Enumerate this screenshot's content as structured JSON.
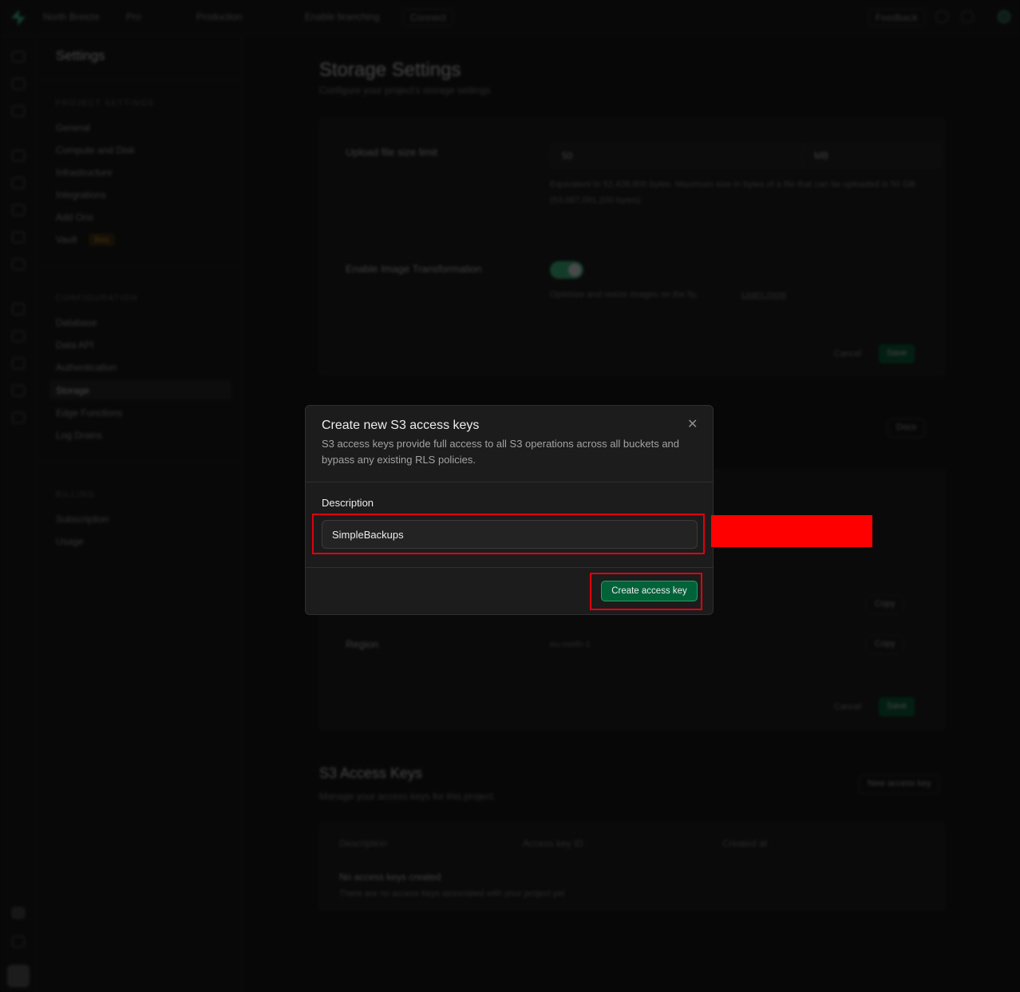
{
  "topbar": {
    "org": "North Breeze",
    "plan": "Pro",
    "branch": "Production",
    "branching": "Enable branching",
    "connect": "Connect",
    "feedback": "Feedback"
  },
  "sidebar": {
    "title": "Settings",
    "sections": [
      {
        "heading": "PROJECT SETTINGS",
        "items": [
          "General",
          "Compute and Disk",
          "Infrastructure",
          "Integrations",
          "Add Ons",
          "Vault"
        ]
      },
      {
        "heading": "CONFIGURATION",
        "items": [
          "Database",
          "Data API",
          "Authentication",
          "Storage",
          "Edge Functions",
          "Log Drains"
        ]
      },
      {
        "heading": "BILLING",
        "items": [
          "Subscription",
          "Usage"
        ]
      }
    ],
    "vault_badge": "Beta",
    "active_item": "Storage"
  },
  "main": {
    "title": "Storage Settings",
    "subtitle": "Configure your project's storage settings",
    "upload_label": "Upload file size limit",
    "upload_value": "50",
    "upload_unit": "MB",
    "upload_help": "Equivalent to 52,428,800 bytes. Maximum size in bytes of a file that can be uploaded is 50 GB (53,687,091,200 bytes).",
    "transform_label": "Enable Image Transformation",
    "transform_help": "Optimize and resize images on the fly.",
    "learn_more": "Learn more",
    "cancel": "Cancel",
    "save": "Save",
    "docs": "Docs",
    "region_label": "Region",
    "region_value": "eu-north-1",
    "copy": "Copy",
    "keys_title": "S3 Access Keys",
    "keys_subtitle": "Manage your access keys for this project.",
    "new_key": "New access key",
    "col_description": "Description",
    "col_key_id": "Access key ID",
    "col_created": "Created at",
    "empty_title": "No access keys created",
    "empty_desc": "There are no access keys associated with your project yet"
  },
  "dialog": {
    "title": "Create new S3 access keys",
    "description": "S3 access keys provide full access to all S3 operations across all buckets and bypass any existing RLS policies.",
    "field_label": "Description",
    "field_value": "SimpleBackups",
    "close_icon": "close-icon",
    "submit_label": "Create access key"
  },
  "colors": {
    "brand": "#3ecf8e",
    "primary_button": "#006239",
    "highlight": "#e0000f",
    "redaction": "#ff0000"
  }
}
